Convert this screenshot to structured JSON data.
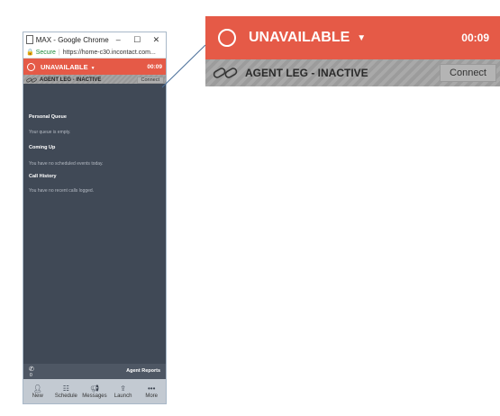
{
  "window": {
    "title": "MAX - Google Chrome",
    "controls": [
      "–",
      "☐",
      "✕"
    ],
    "secure_label": "Secure",
    "url": "https://home-c30.incontact.com..."
  },
  "status": {
    "label": "UNAVAILABLE",
    "timer": "00:09",
    "color": "#e55a47"
  },
  "agent_leg": {
    "label": "AGENT LEG - INACTIVE",
    "connect": "Connect"
  },
  "sections": {
    "queue": {
      "title": "Personal Queue",
      "text": "Your queue is empty."
    },
    "coming": {
      "title": "Coming Up",
      "text": "You have no scheduled events today."
    },
    "history": {
      "title": "Call History",
      "text": "You have no recent calls logged."
    }
  },
  "footer": {
    "call_count": "0",
    "agent_reports": "Agent Reports"
  },
  "nav": [
    {
      "icon": "new-contact-icon",
      "label": "New"
    },
    {
      "icon": "schedule-icon",
      "label": "Schedule"
    },
    {
      "icon": "messages-icon",
      "label": "Messages"
    },
    {
      "icon": "launch-icon",
      "label": "Launch"
    },
    {
      "icon": "more-icon",
      "label": "More"
    }
  ],
  "zoom": {
    "status_label": "UNAVAILABLE",
    "timer": "00:09",
    "agent_leg": "AGENT LEG - INACTIVE",
    "connect": "Connect"
  }
}
